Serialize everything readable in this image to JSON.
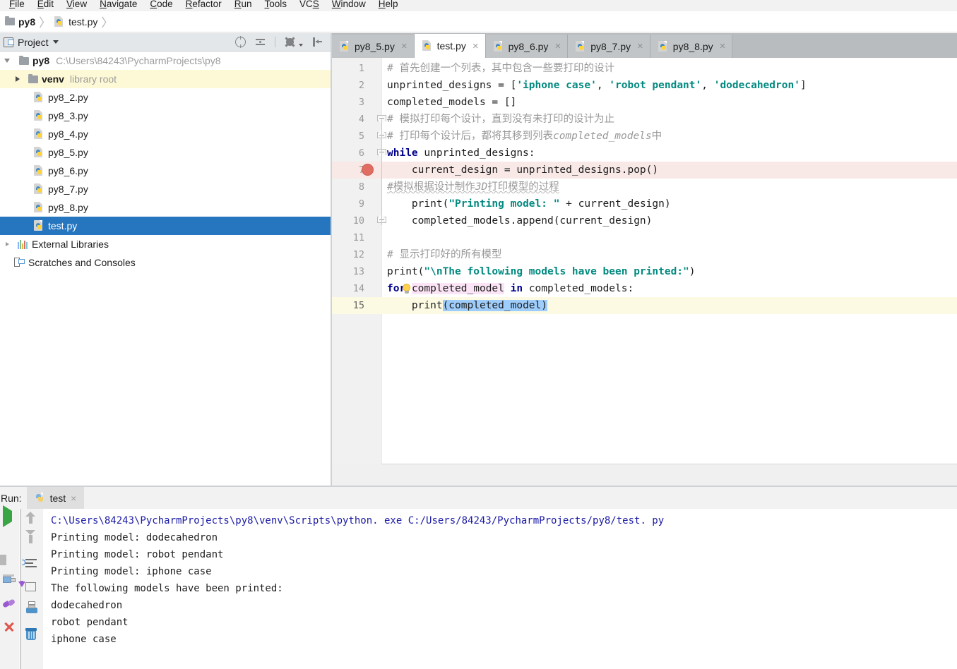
{
  "menubar": {
    "items": [
      "File",
      "Edit",
      "View",
      "Navigate",
      "Code",
      "Refactor",
      "Run",
      "Tools",
      "VCS",
      "Window",
      "Help"
    ]
  },
  "breadcrumb": {
    "project": "py8",
    "file": "test.py",
    "sep": "〉"
  },
  "project_panel": {
    "title": "Project",
    "icons": [
      "locate-target-icon",
      "collapse-all-icon",
      "settings-gear-icon",
      "hide-panel-icon"
    ]
  },
  "tree": {
    "root": {
      "name": "py8",
      "path": "C:\\Users\\84243\\PycharmProjects\\py8"
    },
    "items": [
      {
        "name": "venv",
        "sub": "library root",
        "type": "folder",
        "expandable": true,
        "state": "highlighted"
      },
      {
        "name": "py8_2.py",
        "type": "python"
      },
      {
        "name": "py8_3.py",
        "type": "python"
      },
      {
        "name": "py8_4.py",
        "type": "python"
      },
      {
        "name": "py8_5.py",
        "type": "python"
      },
      {
        "name": "py8_6.py",
        "type": "python"
      },
      {
        "name": "py8_7.py",
        "type": "python"
      },
      {
        "name": "py8_8.py",
        "type": "python"
      },
      {
        "name": "test.py",
        "type": "python",
        "state": "selected"
      }
    ],
    "external_libraries": "External Libraries",
    "scratches": "Scratches and Consoles"
  },
  "editor_tabs": [
    {
      "label": "py8_5.py",
      "active": false
    },
    {
      "label": "test.py",
      "active": true
    },
    {
      "label": "py8_6.py",
      "active": false
    },
    {
      "label": "py8_7.py",
      "active": false
    },
    {
      "label": "py8_8.py",
      "active": false
    }
  ],
  "editor": {
    "close_glyph": "×",
    "lines": [
      {
        "n": "1",
        "text": "# 首先创建一个列表，其中包含一些要打印的设计"
      },
      {
        "n": "2",
        "text": "unprinted_designs = ['iphone case', 'robot pendant', 'dodecahedron']"
      },
      {
        "n": "3",
        "text": "completed_models = []"
      },
      {
        "n": "4",
        "text": "# 模拟打印每个设计，直到没有未打印的设计为止"
      },
      {
        "n": "5",
        "text": "# 打印每个设计后，都将其移到列表completed_models中"
      },
      {
        "n": "6",
        "text": "while unprinted_designs:"
      },
      {
        "n": "7",
        "text": "    current_design = unprinted_designs.pop()"
      },
      {
        "n": "8",
        "text": "#模拟根据设计制作3D打印模型的过程"
      },
      {
        "n": "9",
        "text": "    print(\"Printing model: \" + current_design)"
      },
      {
        "n": "10",
        "text": "    completed_models.append(current_design)"
      },
      {
        "n": "11",
        "text": ""
      },
      {
        "n": "12",
        "text": "# 显示打印好的所有模型"
      },
      {
        "n": "13",
        "text": "print(\"\\nThe following models have been printed:\")"
      },
      {
        "n": "14",
        "text": "for completed_model in completed_models:"
      },
      {
        "n": "15",
        "text": "    print(completed_model)"
      }
    ],
    "breakpoint_line": "7",
    "caret_line": "15",
    "colors": {
      "comment": "#999999",
      "string": "#028a80",
      "keyword": "#00008c",
      "breakpoint": "#e06c62",
      "current_line_bg": "#fdfae3",
      "breakpoint_line_bg": "#f8e9e7",
      "selection_bg": "#9ecdfb",
      "identifier_highlight_bg": "#fbe4f5"
    }
  },
  "run_panel": {
    "label": "Run:",
    "tab": "test",
    "close_glyph": "×",
    "toolbar_left": [
      "run-icon",
      "stop-icon",
      "pause-icon",
      "restore-layout-icon",
      "pin-icon",
      "close-icon"
    ],
    "toolbar_right": [
      "scroll-up-icon",
      "scroll-down-icon",
      "soft-wrap-icon",
      "export-icon",
      "print-icon",
      "clear-all-icon"
    ],
    "console_lines": [
      {
        "text": "C:\\Users\\84243\\PycharmProjects\\py8\\venv\\Scripts\\python. exe C:/Users/84243/PycharmProjects/py8/test. py",
        "kind": "cmd"
      },
      {
        "text": "Printing model: dodecahedron",
        "kind": "out"
      },
      {
        "text": "Printing model: robot pendant",
        "kind": "out"
      },
      {
        "text": "Printing model: iphone case",
        "kind": "out"
      },
      {
        "text": "",
        "kind": "out"
      },
      {
        "text": "The following models have been printed:",
        "kind": "out"
      },
      {
        "text": "dodecahedron",
        "kind": "out"
      },
      {
        "text": "robot pendant",
        "kind": "out"
      },
      {
        "text": "iphone case",
        "kind": "out"
      }
    ]
  }
}
